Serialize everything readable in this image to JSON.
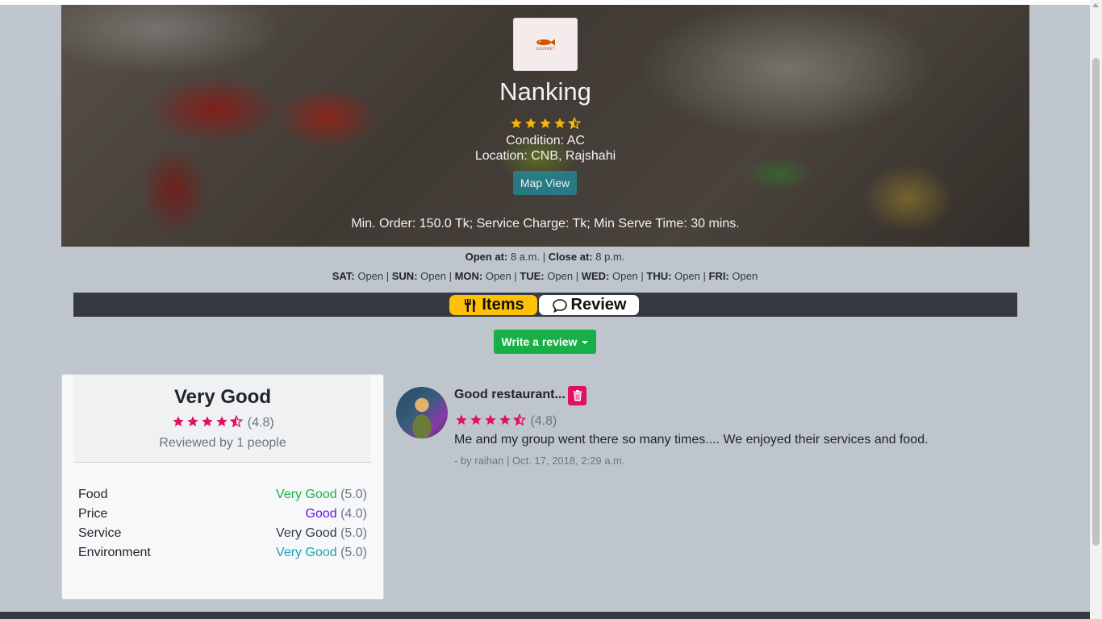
{
  "restaurant": {
    "logo_text": "GOURMET",
    "name": "Nanking",
    "rating": 4.5,
    "condition_label": "Condition:",
    "condition_value": "AC",
    "location_label": "Location:",
    "location_value": "CNB, Rajshahi",
    "map_button": "Map View",
    "order_info": "Min. Order: 150.0 Tk; Service Charge: Tk; Min Serve Time: 30 mins."
  },
  "hours": {
    "open_label": "Open at:",
    "open_value": "8 a.m.",
    "close_label": "Close at:",
    "close_value": "8 p.m.",
    "days": [
      {
        "day": "SAT:",
        "status": "Open"
      },
      {
        "day": "SUN:",
        "status": "Open"
      },
      {
        "day": "MON:",
        "status": "Open"
      },
      {
        "day": "TUE:",
        "status": "Open"
      },
      {
        "day": "WED:",
        "status": "Open"
      },
      {
        "day": "THU:",
        "status": "Open"
      },
      {
        "day": "FRI:",
        "status": "Open"
      }
    ]
  },
  "tabs": {
    "items": "Items",
    "review": "Review"
  },
  "write_review": "Write a review",
  "summary": {
    "verdict": "Very Good",
    "score": "(4.8)",
    "reviewed_by": "Reviewed by 1 people",
    "criteria": [
      {
        "name": "Food",
        "grade": "Very Good",
        "score": "(5.0)",
        "color": "#17b047"
      },
      {
        "name": "Price",
        "grade": "Good",
        "score": "(4.0)",
        "color": "#6610f2"
      },
      {
        "name": "Service",
        "grade": "Very Good",
        "score": "(5.0)",
        "color": "#343a40"
      },
      {
        "name": "Environment",
        "grade": "Very Good",
        "score": "(5.0)",
        "color": "#17a2b8"
      }
    ]
  },
  "review": {
    "title": "Good restaurant...",
    "score": "(4.8)",
    "text": "Me and my group went there so many times.... We enjoyed their services and food.",
    "meta": "- by raihan | Oct. 17, 2018, 2:29 a.m."
  },
  "colors": {
    "star_hero": "#f5b800",
    "star_review": "#e0115f",
    "accent_green": "#17b047",
    "tab_active": "#ffc107"
  }
}
